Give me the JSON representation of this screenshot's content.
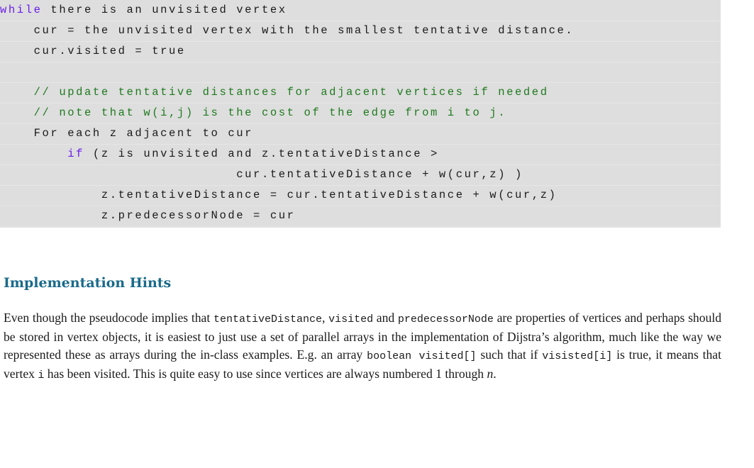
{
  "code": {
    "lines": [
      {
        "indent": "",
        "keyword": "while",
        "text": " there is an unvisited vertex",
        "comment": ""
      },
      {
        "indent": "    ",
        "keyword": "",
        "text": "cur = the unvisited vertex with the smallest tentative distance.",
        "comment": ""
      },
      {
        "indent": "    ",
        "keyword": "",
        "text": "cur.visited = true",
        "comment": ""
      },
      {
        "indent": "",
        "keyword": "",
        "text": "",
        "comment": ""
      },
      {
        "indent": "    ",
        "keyword": "",
        "text": "",
        "comment": "// update tentative distances for adjacent vertices if needed"
      },
      {
        "indent": "    ",
        "keyword": "",
        "text": "",
        "comment": "// note that w(i,j) is the cost of the edge from i to j."
      },
      {
        "indent": "    ",
        "keyword": "",
        "text": "For each z adjacent to cur",
        "comment": ""
      },
      {
        "indent": "        ",
        "keyword": "if",
        "text": " (z is unvisited and z.tentativeDistance >",
        "comment": ""
      },
      {
        "indent": "                            ",
        "keyword": "",
        "text": "cur.tentativeDistance + w(cur,z) )",
        "comment": ""
      },
      {
        "indent": "            ",
        "keyword": "",
        "text": "z.tentativeDistance = cur.tentativeDistance + w(cur,z)",
        "comment": ""
      },
      {
        "indent": "            ",
        "keyword": "",
        "text": "z.predecessorNode = cur",
        "comment": ""
      }
    ]
  },
  "section": {
    "heading": "Implementation Hints",
    "paragraph": [
      {
        "t": "Even though the pseudocode implies that ",
        "s": ""
      },
      {
        "t": "tentativeDistance",
        "s": "tt"
      },
      {
        "t": ", ",
        "s": ""
      },
      {
        "t": "visited",
        "s": "tt"
      },
      {
        "t": " and ",
        "s": ""
      },
      {
        "t": "predecessorNode",
        "s": "tt"
      },
      {
        "t": " are properties of vertices and perhaps should be stored in vertex objects, it is easiest to just use a set of parallel arrays in the implementation of Dijstra’s algorithm, much like the way we represented these as arrays during the in-class examples.  E.g. an array ",
        "s": ""
      },
      {
        "t": "boolean visited[]",
        "s": "tt"
      },
      {
        "t": " such that if ",
        "s": ""
      },
      {
        "t": "visisted[i]",
        "s": "tt"
      },
      {
        "t": " is true, it means that vertex ",
        "s": ""
      },
      {
        "t": "i",
        "s": "tt"
      },
      {
        "t": " has been visited.  This is quite easy to use since vertices are always numbered 1 through ",
        "s": ""
      },
      {
        "t": "n",
        "s": "it"
      },
      {
        "t": ".",
        "s": ""
      }
    ]
  }
}
